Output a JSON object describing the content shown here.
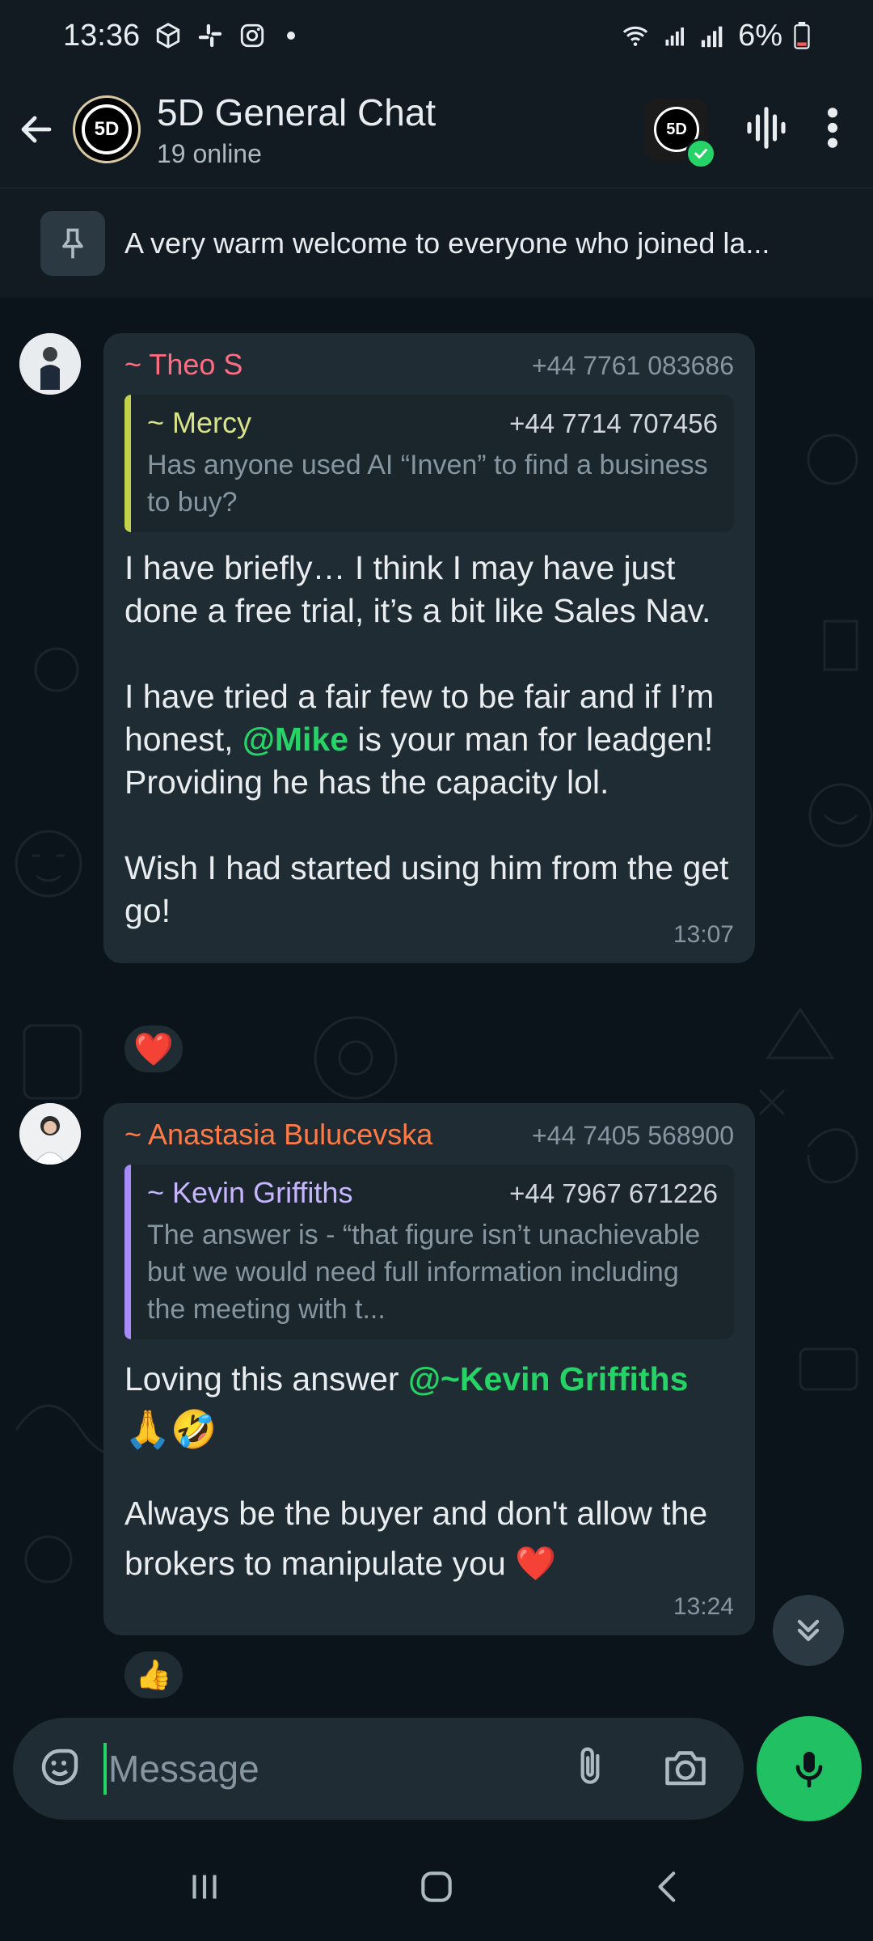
{
  "status_bar": {
    "time": "13:36",
    "battery": "6%"
  },
  "header": {
    "title": "5D General Chat",
    "subtitle": "19 online",
    "avatar_text": "5D"
  },
  "pinned": {
    "text": "A very warm welcome to everyone who joined la..."
  },
  "messages": [
    {
      "sender": "~ Theo S",
      "sender_color": "#ff6b81",
      "phone": "+44 7761 083686",
      "quote": {
        "name": "~ Mercy",
        "name_color": "#d9e38a",
        "bar_color": "#c4d14a",
        "phone": "+44 7714 707456",
        "text": "Has anyone used AI “Inven” to find a business to buy?"
      },
      "body": {
        "p1": "I have briefly… I think I may have just done a free trial, it’s a bit like Sales Nav.",
        "p2_before": "I have tried a fair few to be fair and if I’m honest, ",
        "p2_mention": "@Mike",
        "p2_after": " is your man for leadgen! Providing he has the capacity lol.",
        "p3": "Wish I had started using him from the get go!"
      },
      "time": "13:07",
      "reaction": "❤️"
    },
    {
      "sender": "~ Anastasia Bulucevska",
      "sender_color": "#ff7a45",
      "phone": "+44 7405 568900",
      "quote": {
        "name": "~ Kevin Griffiths",
        "name_color": "#c7b6ff",
        "bar_color": "#a78bfa",
        "phone": "+44 7967 671226",
        "text": "The answer is - “that figure isn’t unachievable but we would need full information including the meeting with t..."
      },
      "body": {
        "p1_before": "Loving this answer ",
        "p1_mention": "@~Kevin Griffiths",
        "p1_emoji": "🙏🤣",
        "p2": "Always be the buyer and don't allow the brokers to manipulate you ❤️"
      },
      "time": "13:24",
      "reaction": "👍"
    }
  ],
  "composer": {
    "placeholder": "Message"
  },
  "colors": {
    "accent": "#25d366",
    "bubble": "#1f2c33",
    "background": "#0b141a"
  }
}
